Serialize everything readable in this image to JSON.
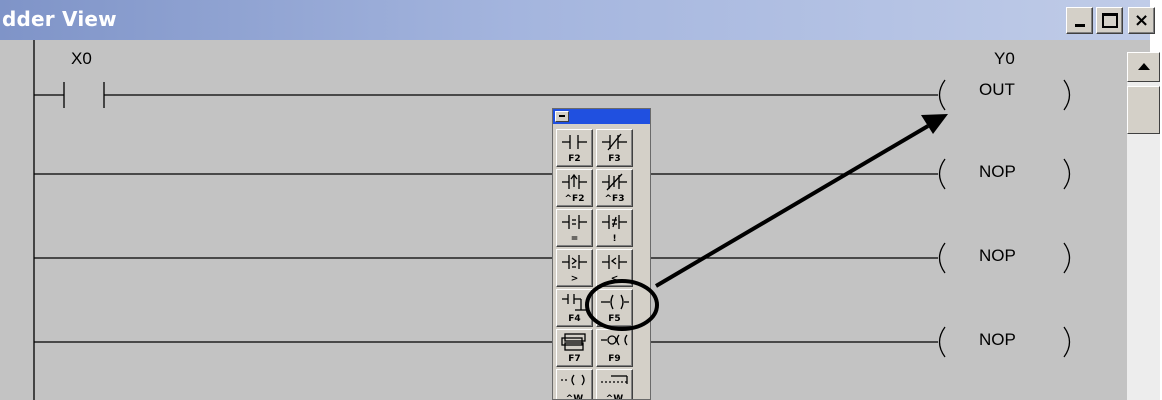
{
  "window": {
    "title": "dder View",
    "controls": {
      "minimize": "minimize",
      "maximize": "maximize",
      "close": "×"
    }
  },
  "rungs": [
    {
      "contact": "X0",
      "coil_name": "Y0",
      "coil_instruction": "OUT"
    },
    {
      "coil_instruction": "NOP"
    },
    {
      "coil_instruction": "NOP"
    },
    {
      "coil_instruction": "NOP"
    }
  ],
  "palette": {
    "buttons": [
      {
        "name": "normally-open-contact",
        "key": "F2"
      },
      {
        "name": "normally-closed-contact",
        "key": "F3"
      },
      {
        "name": "rising-edge-contact",
        "key": "^F2"
      },
      {
        "name": "falling-edge-contact",
        "key": "^F3"
      },
      {
        "name": "equal-compare-contact",
        "key": "="
      },
      {
        "name": "not-equal-compare-contact",
        "key": "!"
      },
      {
        "name": "greater-equal-compare-contact",
        "key": ">"
      },
      {
        "name": "less-compare-contact",
        "key": "<"
      },
      {
        "name": "branch-contact",
        "key": "F4"
      },
      {
        "name": "output-coil",
        "key": "F5"
      },
      {
        "name": "box-instruction",
        "key": "F7"
      },
      {
        "name": "function-instruction",
        "key": "F9"
      },
      {
        "name": "w-contact",
        "key": "^W"
      },
      {
        "name": "w-instruction",
        "key": "^W"
      }
    ]
  },
  "colors": {
    "title_bar_start": "#7f94c8",
    "title_bar_end": "#c0cce8",
    "ladder_background": "#c3c3c3",
    "palette_header": "#2050e0",
    "annotation": "#000000"
  }
}
